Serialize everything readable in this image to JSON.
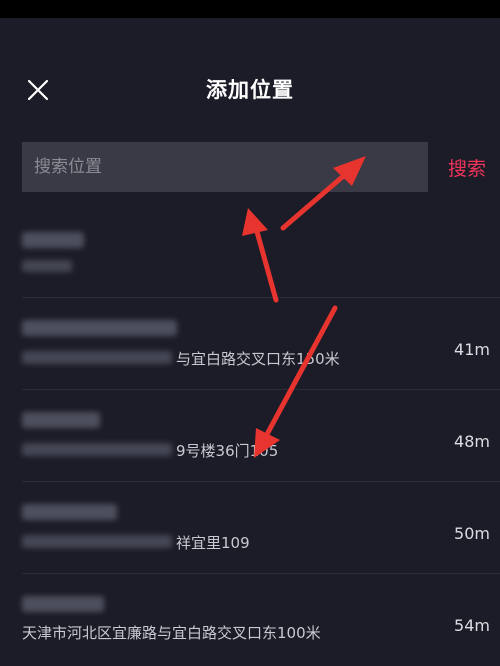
{
  "header": {
    "title": "添加位置",
    "close_icon": "close-icon"
  },
  "search": {
    "placeholder": "搜索位置",
    "button_label": "搜索",
    "button_color": "#f0345a"
  },
  "locations": [
    {
      "address": "",
      "distance": ""
    },
    {
      "address": "与宜白路交叉口东150米",
      "distance": "41m"
    },
    {
      "address": "9号楼36门105",
      "distance": "48m"
    },
    {
      "address": "祥宜里109",
      "distance": "50m"
    },
    {
      "address": "天津市河北区宜廉路与宜白路交叉口东100米",
      "distance": "54m"
    }
  ],
  "annotation": {
    "arrow_color": "#e8342e"
  }
}
